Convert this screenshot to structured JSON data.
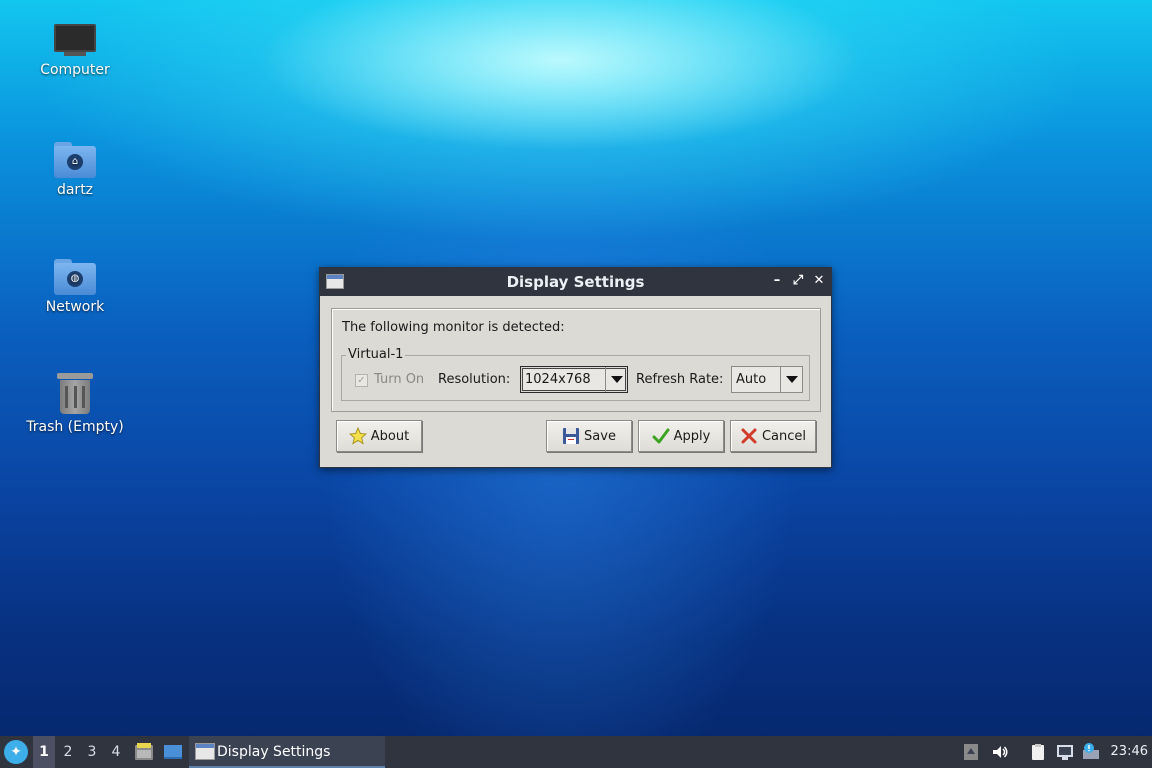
{
  "desktop": {
    "icons": [
      {
        "label": "Computer",
        "icon": "computer-icon"
      },
      {
        "label": "dartz",
        "icon": "home-folder-icon"
      },
      {
        "label": "Network",
        "icon": "network-folder-icon"
      },
      {
        "label": "Trash (Empty)",
        "icon": "trash-icon"
      }
    ]
  },
  "dialog": {
    "title": "Display Settings",
    "detected_text": "The following monitor is detected:",
    "monitor_name": "Virtual-1",
    "turn_on_label": "Turn On",
    "turn_on_checked": true,
    "turn_on_enabled": false,
    "resolution_label": "Resolution:",
    "resolution_value": "1024x768",
    "refresh_rate_label": "Refresh Rate:",
    "refresh_rate_value": "Auto",
    "buttons": {
      "about": "About",
      "save": "Save",
      "apply": "Apply",
      "cancel": "Cancel"
    }
  },
  "taskbar": {
    "workspaces": [
      "1",
      "2",
      "3",
      "4"
    ],
    "active_workspace": "1",
    "task_label": "Display Settings",
    "clock": "23:46"
  },
  "colors": {
    "titlebar": "#2f343f",
    "dialog_bg": "#dcdad5",
    "taskbar": "#2f343f",
    "accent": "#3daee9"
  }
}
